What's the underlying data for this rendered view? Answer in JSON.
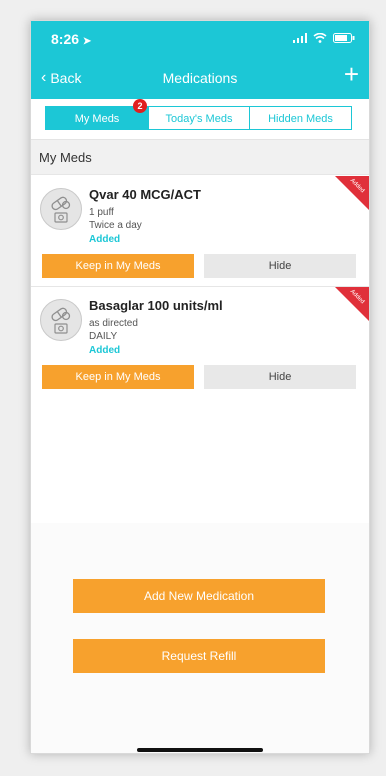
{
  "status_bar": {
    "time": "8:26"
  },
  "nav": {
    "back_label": "Back",
    "title": "Medications",
    "add_label": "+"
  },
  "tabs": [
    {
      "label": "My Meds",
      "active": true,
      "badge": "2"
    },
    {
      "label": "Today's Meds",
      "active": false
    },
    {
      "label": "Hidden Meds",
      "active": false
    }
  ],
  "section": {
    "title": "My Meds"
  },
  "meds": [
    {
      "name": "Qvar 40 MCG/ACT",
      "dose": "1 puff",
      "frequency": "Twice a day",
      "status": "Added",
      "corner_tag": "Added",
      "keep_label": "Keep in My Meds",
      "hide_label": "Hide"
    },
    {
      "name": "Basaglar 100 units/ml",
      "dose": "as directed",
      "frequency": "DAILY",
      "status": "Added",
      "corner_tag": "Added",
      "keep_label": "Keep in My Meds",
      "hide_label": "Hide"
    }
  ],
  "actions": {
    "add_new": "Add New Medication",
    "request_refill": "Request Refill"
  },
  "colors": {
    "accent": "#1cc7d6",
    "orange": "#f7a12d",
    "badge_red": "#e02020"
  }
}
